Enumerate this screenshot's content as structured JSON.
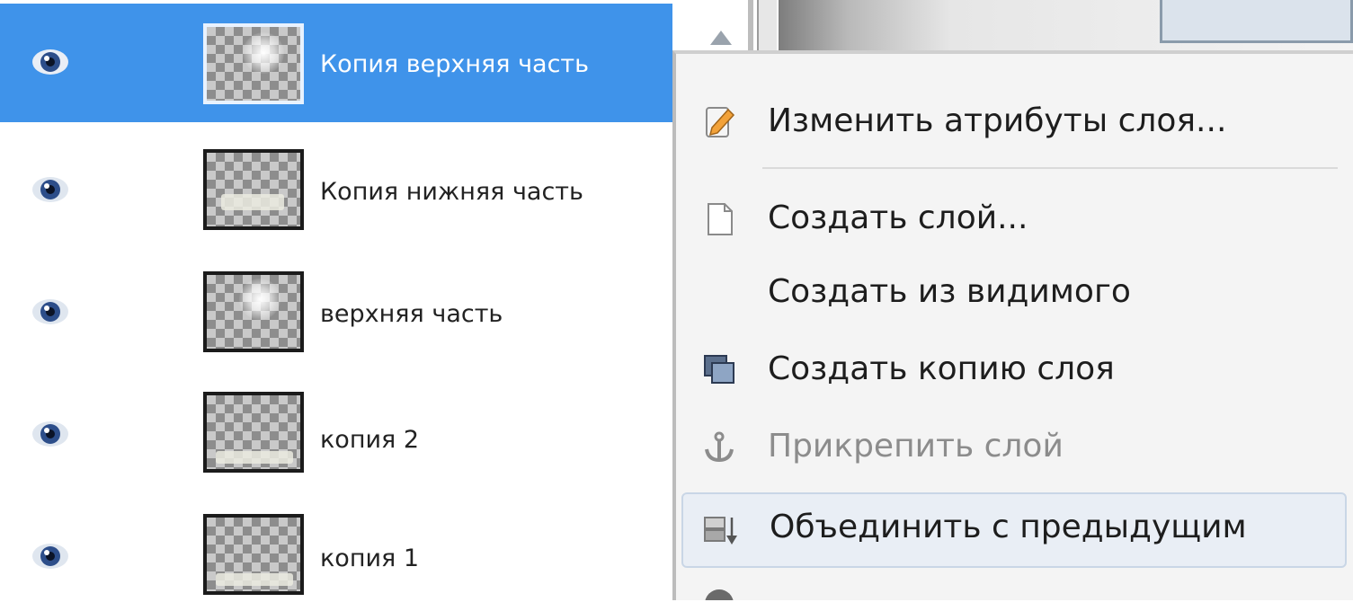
{
  "layers_panel": {
    "layers": [
      {
        "name": "Копия верхняя часть",
        "selected": true,
        "visible": true
      },
      {
        "name": "Копия нижняя часть",
        "selected": false,
        "visible": true
      },
      {
        "name": "верхняя часть",
        "selected": false,
        "visible": true
      },
      {
        "name": "копия 2",
        "selected": false,
        "visible": true
      },
      {
        "name": "копия 1",
        "selected": false,
        "visible": true
      }
    ]
  },
  "context_menu": {
    "items": [
      {
        "label": "Изменить атрибуты слоя...",
        "icon": "pencil-icon",
        "enabled": true
      },
      {
        "label": "Создать слой...",
        "icon": "new-page-icon",
        "enabled": true
      },
      {
        "label": "Создать из видимого",
        "icon": "",
        "enabled": true
      },
      {
        "label": "Создать копию слоя",
        "icon": "duplicate-layer-icon",
        "enabled": true
      },
      {
        "label": "Прикрепить слой",
        "icon": "anchor-icon",
        "enabled": false
      },
      {
        "label": "Объединить с предыдущим",
        "icon": "merge-down-icon",
        "enabled": true,
        "highlighted": true
      }
    ]
  },
  "colors": {
    "selection": "#3f93ea",
    "menu_background": "#f4f4f4",
    "disabled_text": "#8c8c8c"
  }
}
